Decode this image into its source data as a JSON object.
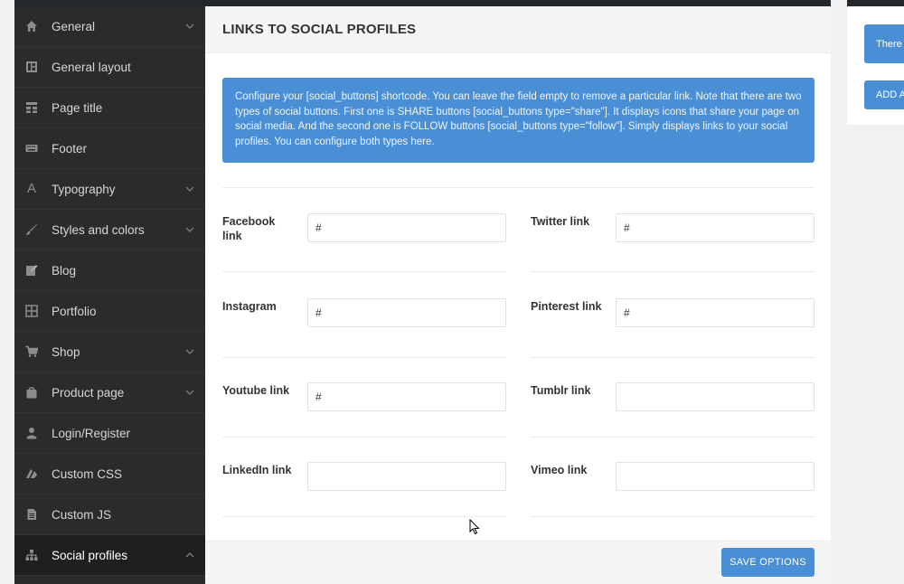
{
  "sidebar": {
    "items": [
      {
        "label": "General",
        "icon": "home-icon",
        "expandable": true
      },
      {
        "label": "General layout",
        "icon": "layout-icon",
        "expandable": false
      },
      {
        "label": "Page title",
        "icon": "page-title-icon",
        "expandable": false
      },
      {
        "label": "Footer",
        "icon": "keyboard-icon",
        "expandable": false
      },
      {
        "label": "Typography",
        "icon": "font-icon",
        "expandable": true
      },
      {
        "label": "Styles and colors",
        "icon": "brush-icon",
        "expandable": true
      },
      {
        "label": "Blog",
        "icon": "edit-icon",
        "expandable": false
      },
      {
        "label": "Portfolio",
        "icon": "grid-icon",
        "expandable": false
      },
      {
        "label": "Shop",
        "icon": "cart-icon",
        "expandable": true
      },
      {
        "label": "Product page",
        "icon": "bag-icon",
        "expandable": true
      },
      {
        "label": "Login/Register",
        "icon": "user-icon",
        "expandable": false
      },
      {
        "label": "Custom CSS",
        "icon": "css-icon",
        "expandable": false
      },
      {
        "label": "Custom JS",
        "icon": "file-icon",
        "expandable": false
      },
      {
        "label": "Social profiles",
        "icon": "sitemap-icon",
        "expandable": true,
        "active": true
      }
    ]
  },
  "main": {
    "title": "LINKS TO SOCIAL PROFILES",
    "notice": "Configure your [social_buttons] shortcode. You can leave the field empty to remove a particular link. Note that there are two types of social buttons. First one is SHARE buttons [social_buttons type=\"share\"]. It displays icons that share your page on social media. And the second one is FOLLOW buttons [social_buttons type=\"follow\"]. Simply displays links to your social profiles. You can configure both types here.",
    "fields": {
      "facebook": {
        "label": "Facebook link",
        "value": "#"
      },
      "twitter": {
        "label": "Twitter link",
        "value": "#"
      },
      "instagram": {
        "label": "Instagram",
        "value": "#"
      },
      "pinterest": {
        "label": "Pinterest link",
        "value": "#"
      },
      "youtube": {
        "label": "Youtube link",
        "value": "#"
      },
      "tumblr": {
        "label": "Tumblr link",
        "value": ""
      },
      "linkedin": {
        "label": "LinkedIn link",
        "value": ""
      },
      "vimeo": {
        "label": "Vimeo link",
        "value": ""
      }
    },
    "save_label": "SAVE OPTIONS"
  },
  "right_panel": {
    "button1_label": "There",
    "button2_label": "ADD A"
  },
  "colors": {
    "accent": "#4a8fd5",
    "sidebar_bg": "#2b2b2b",
    "sidebar_active_bg": "#1f1f1f"
  }
}
